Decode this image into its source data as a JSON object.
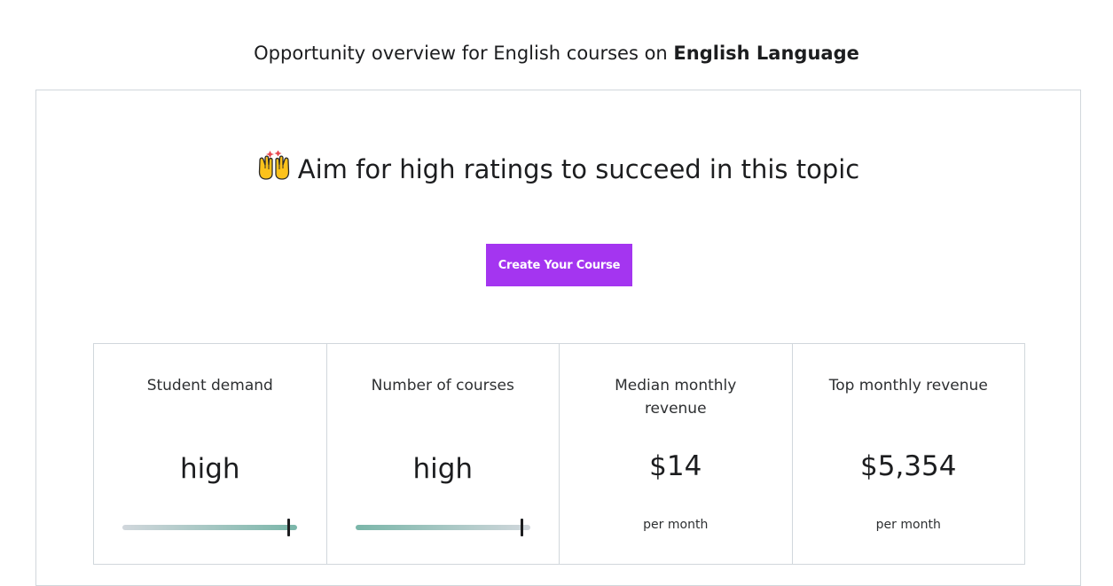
{
  "header": {
    "prefix": "Opportunity overview for English courses on ",
    "topic": "English Language"
  },
  "headline": {
    "emoji_icon": "raising-hands-emoji",
    "text": "Aim for high ratings to succeed in this topic"
  },
  "cta": {
    "label": "Create Your Course",
    "color": "#a435f0"
  },
  "metrics": [
    {
      "label": "Student demand",
      "value": "high",
      "gauge_level": 0.95,
      "gauge_colors": [
        "#d1d7dc",
        "#7ab6a9"
      ]
    },
    {
      "label": "Number of courses",
      "value": "high",
      "gauge_level": 0.95,
      "gauge_colors": [
        "#7ab6a9",
        "#d1d7dc"
      ]
    },
    {
      "label": "Median monthly revenue",
      "value": "$14",
      "sub": "per month"
    },
    {
      "label": "Top monthly revenue",
      "value": "$5,354",
      "sub": "per month"
    }
  ]
}
